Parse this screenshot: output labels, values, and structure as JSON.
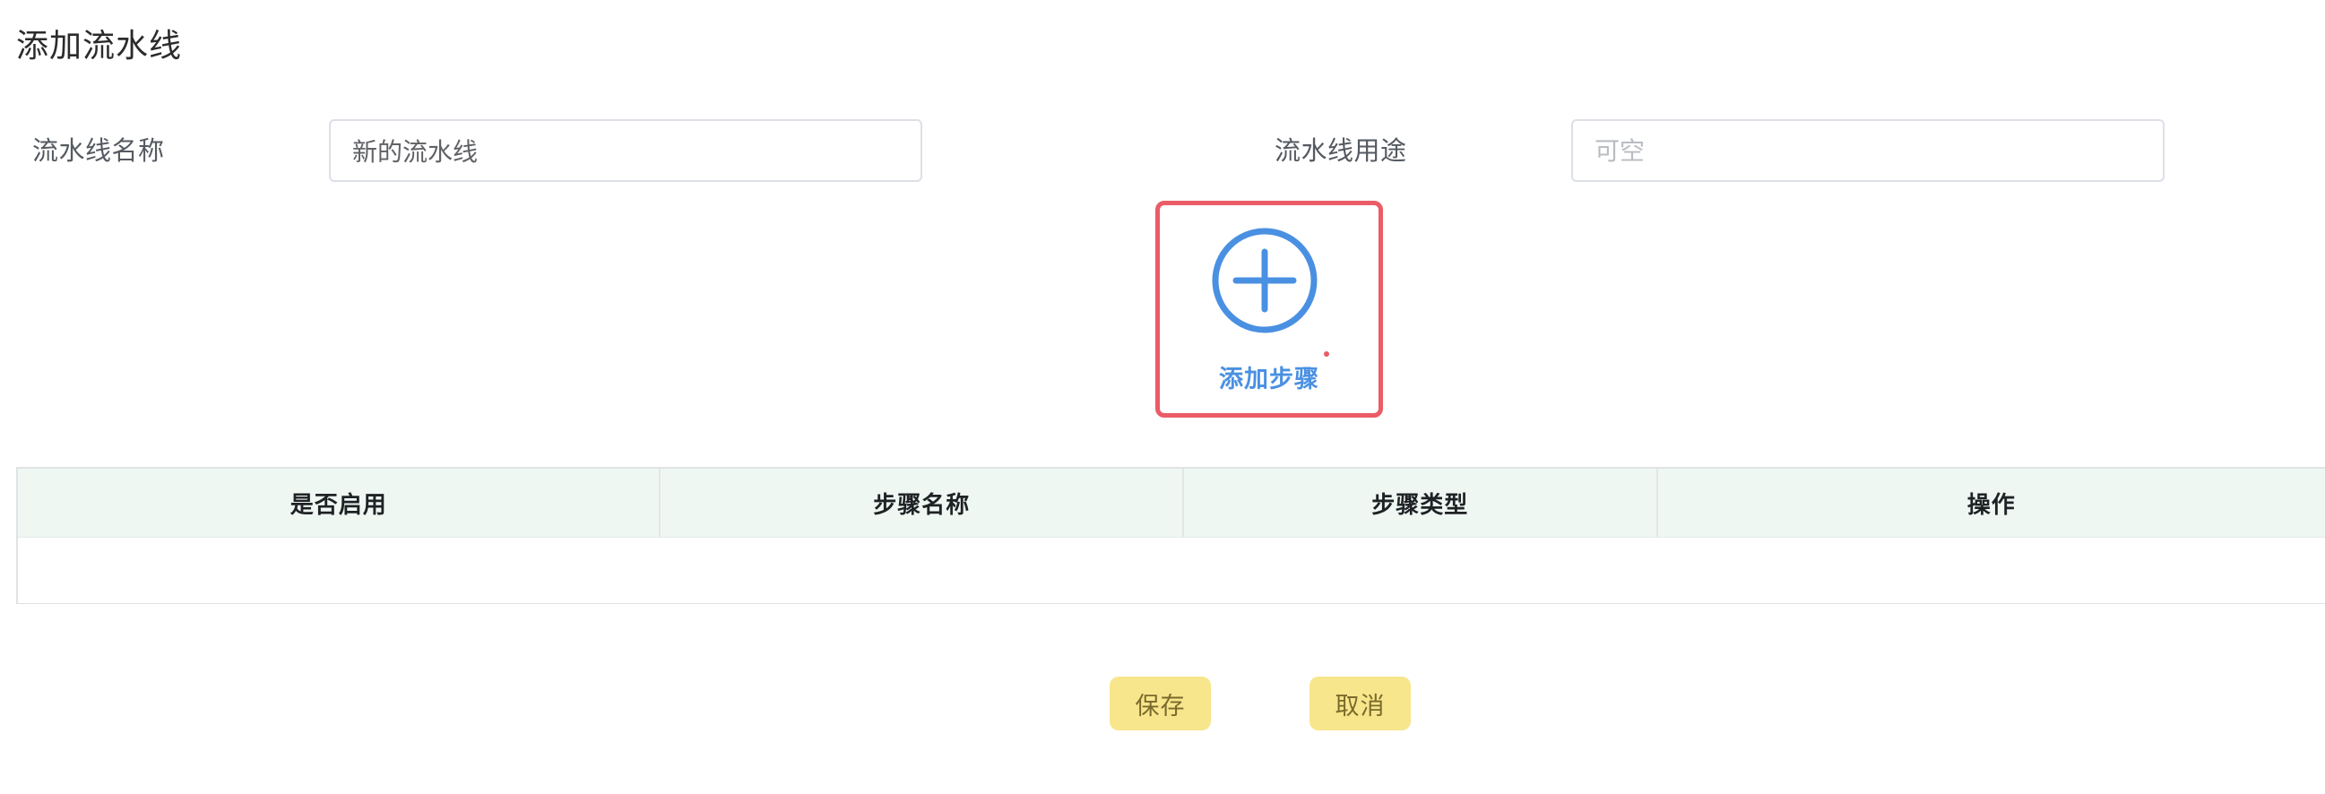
{
  "header": {
    "title": "添加流水线"
  },
  "form": {
    "name_label": "流水线名称",
    "name_value": "新的流水线",
    "purpose_label": "流水线用途",
    "purpose_placeholder": "可空"
  },
  "add_step": {
    "label": "添加步骤",
    "icon": "plus-circle-icon",
    "accent_color": "#4a90e2",
    "highlight_color": "#ea5c66"
  },
  "table": {
    "columns": [
      "是否启用",
      "步骤名称",
      "步骤类型",
      "操作"
    ],
    "rows": []
  },
  "actions": {
    "save_label": "保存",
    "cancel_label": "取消",
    "button_color": "#f7e68c"
  }
}
